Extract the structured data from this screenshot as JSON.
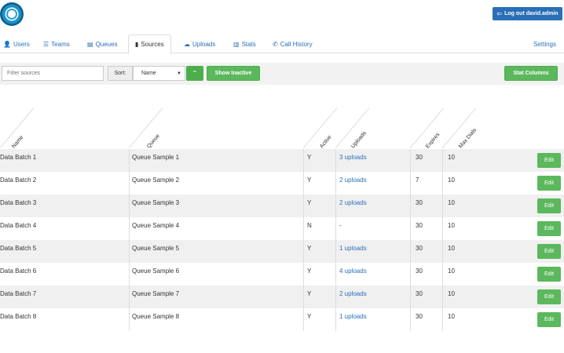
{
  "header": {
    "logo_icon": "circle-logo-icon",
    "logout_icon": "logout-icon",
    "logout_label": "Log out david.admin",
    "brand_color": "#2a6fb6"
  },
  "nav": {
    "tabs": [
      {
        "label": "Users",
        "icon": "user-icon",
        "glyph": "👤"
      },
      {
        "label": "Teams",
        "icon": "list-icon",
        "glyph": "☰"
      },
      {
        "label": "Queues",
        "icon": "queue-icon",
        "glyph": "▤"
      },
      {
        "label": "Sources",
        "icon": "book-icon",
        "glyph": "▮",
        "active": true
      },
      {
        "label": "Uploads",
        "icon": "cloud-upload-icon",
        "glyph": "☁"
      },
      {
        "label": "Stats",
        "icon": "bar-chart-icon",
        "glyph": "▥"
      },
      {
        "label": "Call History",
        "icon": "phone-icon",
        "glyph": "✆"
      }
    ],
    "settings_label": "Settings"
  },
  "toolbar": {
    "filter_placeholder": "Filter sources",
    "sort_label": "Sort:",
    "sort_value": "Name",
    "sort_direction_icon": "chevron-up-icon",
    "show_inactive_label": "Show Inactive",
    "stat_columns_label": "Stat Columns",
    "button_color": "#5cb85c"
  },
  "table": {
    "columns": [
      "Name",
      "Queue",
      "Active",
      "Uploads",
      "Expires",
      "Max Dials"
    ],
    "edit_label": "Edit",
    "rows": [
      {
        "name": "Data Batch 1",
        "queue": "Queue Sample 1",
        "active": "Y",
        "uploads": "3 uploads",
        "expires": "30",
        "max_dials": "10"
      },
      {
        "name": "Data Batch 2",
        "queue": "Queue Sample 2",
        "active": "Y",
        "uploads": "2 uploads",
        "expires": "7",
        "max_dials": "10"
      },
      {
        "name": "Data Batch 3",
        "queue": "Queue Sample 3",
        "active": "Y",
        "uploads": "2 uploads",
        "expires": "30",
        "max_dials": "10"
      },
      {
        "name": "Data Batch 4",
        "queue": "Queue Sample 4",
        "active": "N",
        "uploads": "-",
        "expires": "30",
        "max_dials": "10"
      },
      {
        "name": "Data Batch 5",
        "queue": "Queue Sample 5",
        "active": "Y",
        "uploads": "1 uploads",
        "expires": "30",
        "max_dials": "10"
      },
      {
        "name": "Data Batch 6",
        "queue": "Queue Sample 6",
        "active": "Y",
        "uploads": "4 uploads",
        "expires": "30",
        "max_dials": "10"
      },
      {
        "name": "Data Batch 7",
        "queue": "Queue Sample 7",
        "active": "Y",
        "uploads": "2 uploads",
        "expires": "30",
        "max_dials": "10"
      },
      {
        "name": "Data Batch 8",
        "queue": "Queue Sample 8",
        "active": "Y",
        "uploads": "1 uploads",
        "expires": "30",
        "max_dials": "10"
      }
    ]
  }
}
